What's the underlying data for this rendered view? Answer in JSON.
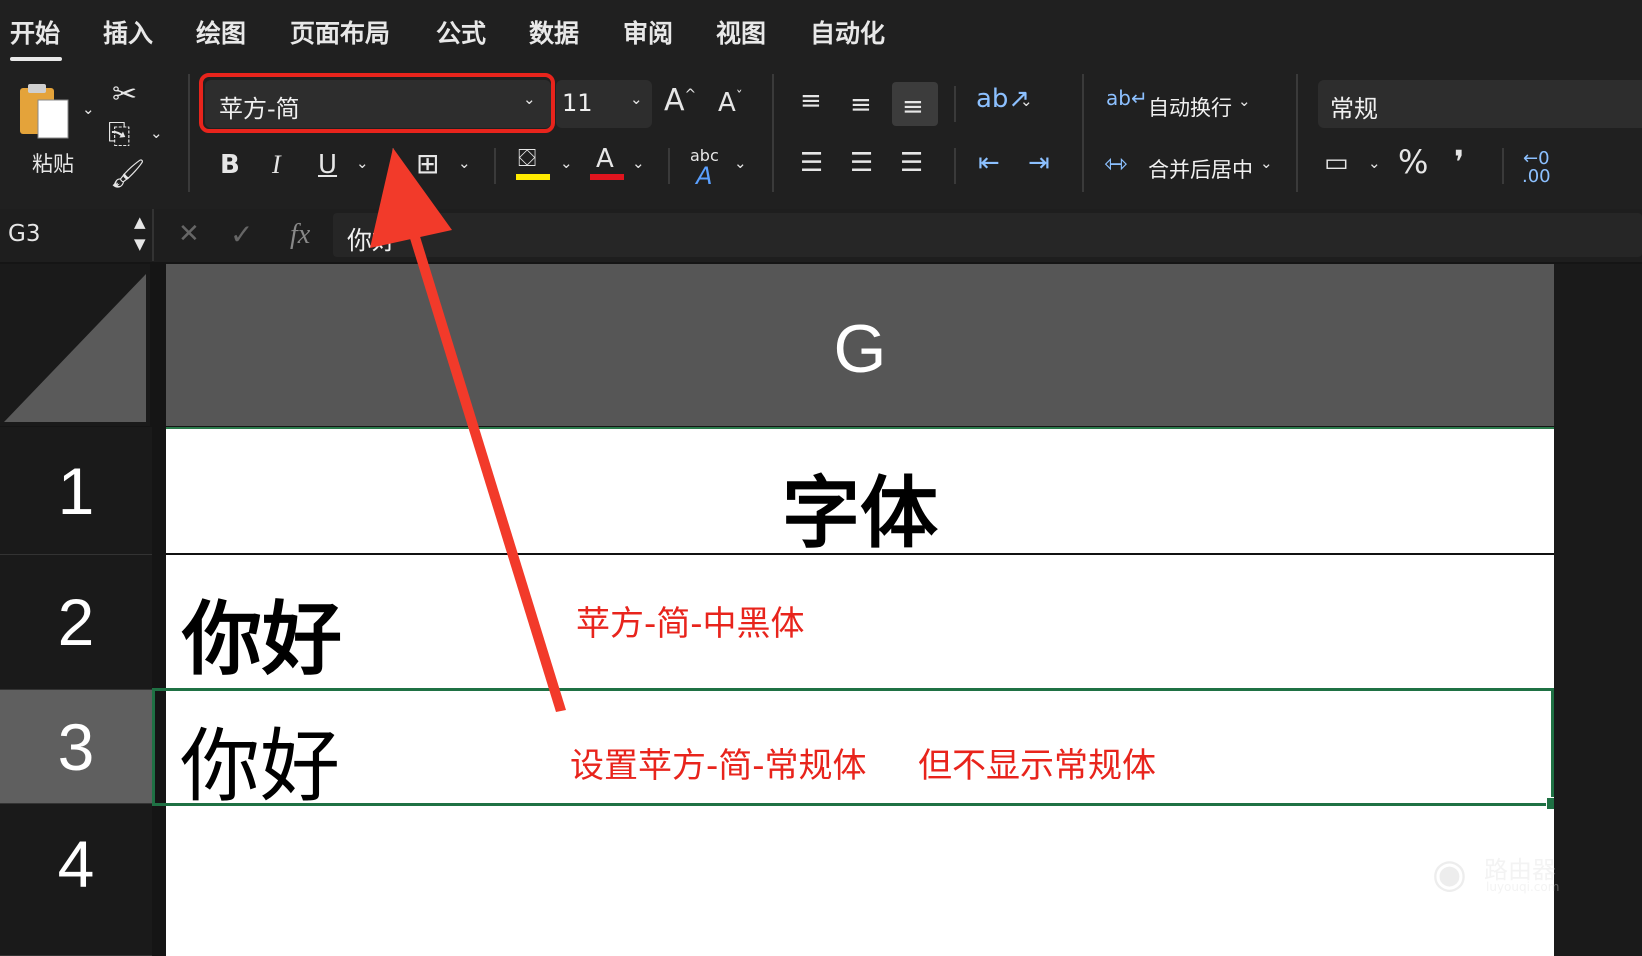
{
  "tabs": [
    "开始",
    "插入",
    "绘图",
    "页面布局",
    "公式",
    "数据",
    "审阅",
    "视图",
    "自动化"
  ],
  "active_tab": "开始",
  "clipboard": {
    "paste_label": "粘贴"
  },
  "font": {
    "name": "苹方-简",
    "size": "11"
  },
  "format_buttons": {
    "bold": "B",
    "italic": "I",
    "underline": "U"
  },
  "alignment": {
    "wrap_label": "自动换行",
    "merge_label": "合并后居中"
  },
  "number": {
    "format": "常规",
    "percent": "%",
    "comma": "❜"
  },
  "formula_bar": {
    "name_box": "G3",
    "fx": "fx",
    "value": "你好"
  },
  "sheet": {
    "column": "G",
    "rows": [
      "1",
      "2",
      "3",
      "4"
    ],
    "cells": {
      "g1": "字体",
      "g2": "你好",
      "g3": "你好"
    }
  },
  "annotations": {
    "row2_note": "苹方-简-中黑体",
    "row3_note_a": "设置苹方-简-常规体",
    "row3_note_b": "但不显示常规体"
  },
  "watermark": {
    "text": "路由器",
    "sub": "luyouqi.com"
  },
  "colors": {
    "highlight": "#ffeb00",
    "font_color": "#e0141e",
    "annotation": "#e8241c",
    "arrow": "#f23a2a",
    "selection": "#1f7144"
  }
}
